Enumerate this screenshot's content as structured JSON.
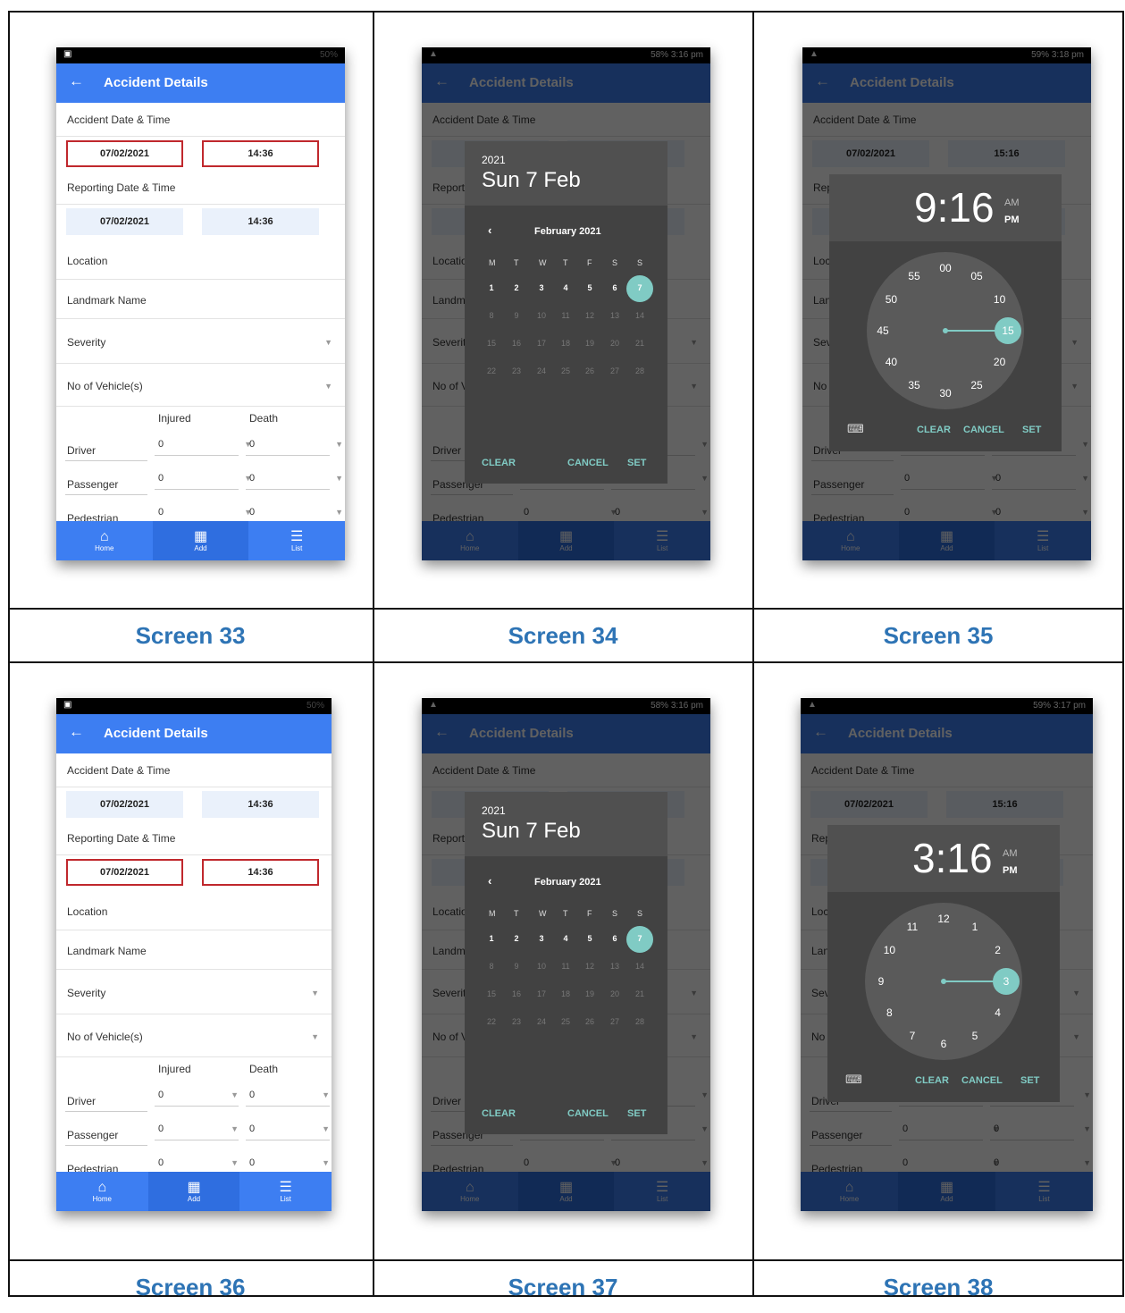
{
  "captions": [
    "Screen 33",
    "Screen 34",
    "Screen 35",
    "Screen 36",
    "Screen 37",
    "Screen 38"
  ],
  "app": {
    "title": "Accident Details",
    "back_icon": "arrow-left-icon",
    "battery_faint": "50%",
    "accident_label": "Accident Date & Time",
    "reporting_label": "Reporting Date & Time",
    "date_value": "07/02/2021",
    "time_value": "14:36",
    "location_label": "Location",
    "landmark_label": "Landmark Name",
    "severity_label": "Severity",
    "vehicles_label": "No of Vehicle(s)",
    "col_injured": "Injured",
    "col_death": "Death",
    "rows": [
      {
        "label": "Driver",
        "injured": "0",
        "death": "0"
      },
      {
        "label": "Passenger",
        "injured": "0",
        "death": "0"
      },
      {
        "label": "Pedestrian",
        "injured": "0",
        "death": "0"
      }
    ],
    "nav": [
      {
        "label": "Home",
        "icon": "home-icon"
      },
      {
        "label": "Add",
        "icon": "grid-icon"
      },
      {
        "label": "List",
        "icon": "list-icon"
      }
    ]
  },
  "status_bars": {
    "s34": "58% 3:16 pm",
    "s35": "59% 3:18 pm",
    "s37": "58% 3:16 pm",
    "s38": "59% 3:17 pm"
  },
  "date_picker": {
    "year": "2021",
    "date": "Sun 7 Feb",
    "month": "February 2021",
    "weekdays": [
      "M",
      "T",
      "W",
      "T",
      "F",
      "S",
      "S"
    ],
    "weeks": [
      [
        "",
        "1",
        "2",
        "3",
        "4",
        "5",
        "6",
        "7"
      ],
      [
        "8",
        "9",
        "10",
        "11",
        "12",
        "13",
        "14"
      ],
      [
        "15",
        "16",
        "17",
        "18",
        "19",
        "20",
        "21"
      ],
      [
        "22",
        "23",
        "24",
        "25",
        "26",
        "27",
        "28"
      ]
    ],
    "selected_day": "7",
    "clear": "CLEAR",
    "cancel": "CANCEL",
    "set": "SET"
  },
  "time_picker_35": {
    "hour": "9",
    "minutes": "16",
    "am": "AM",
    "pm": "PM",
    "time_value": "15:16",
    "dial": [
      "00",
      "05",
      "10",
      "15",
      "20",
      "25",
      "30",
      "35",
      "40",
      "45",
      "50",
      "55"
    ],
    "selected": "15",
    "keyboard_icon": "keyboard-icon",
    "clear": "CLEAR",
    "cancel": "CANCEL",
    "set": "SET"
  },
  "time_picker_38": {
    "hour": "3",
    "minutes": "16",
    "am": "AM",
    "pm": "PM",
    "time_value": "15:16",
    "dial": [
      "12",
      "1",
      "2",
      "3",
      "4",
      "5",
      "6",
      "7",
      "8",
      "9",
      "10",
      "11"
    ],
    "selected": "3",
    "keyboard_icon": "keyboard-icon",
    "clear": "CLEAR",
    "cancel": "CANCEL",
    "set": "SET"
  },
  "colors": {
    "accent": "#3d7ef2",
    "highlight": "#c0282d",
    "teal": "#80cbc4",
    "caption": "#2e74b5"
  }
}
